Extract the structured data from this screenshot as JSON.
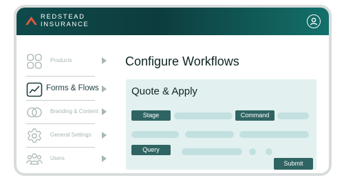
{
  "app": {
    "brand_line1": "REDSTEAD",
    "brand_line2": "INSURANCE",
    "brand_icon": "chevron-peak-logo",
    "colors": {
      "header_dark": "#0d3c3d",
      "header_light": "#13706a",
      "logo_accent": "#e05a3f",
      "button": "#2f6462",
      "panel": "#e2f1f0",
      "placeholder": "#c3e0e0"
    }
  },
  "header": {
    "user_icon": "user-circle-icon"
  },
  "sidebar": {
    "items": [
      {
        "label": "Products",
        "icon": "products-grid-icon",
        "active": false
      },
      {
        "label": "Forms & Flows",
        "icon": "trend-line-icon",
        "active": true
      },
      {
        "label": "Branding & Content",
        "icon": "overlap-circles-icon",
        "active": false
      },
      {
        "label": "General Settings",
        "icon": "gear-icon",
        "active": false
      },
      {
        "label": "Users",
        "icon": "users-group-icon",
        "active": false
      }
    ]
  },
  "main": {
    "title": "Configure Workflows",
    "panel": {
      "title": "Quote & Apply",
      "chips": {
        "stage": "Stage",
        "command": "Command",
        "query": "Query"
      },
      "submit_label": "Submit"
    }
  }
}
